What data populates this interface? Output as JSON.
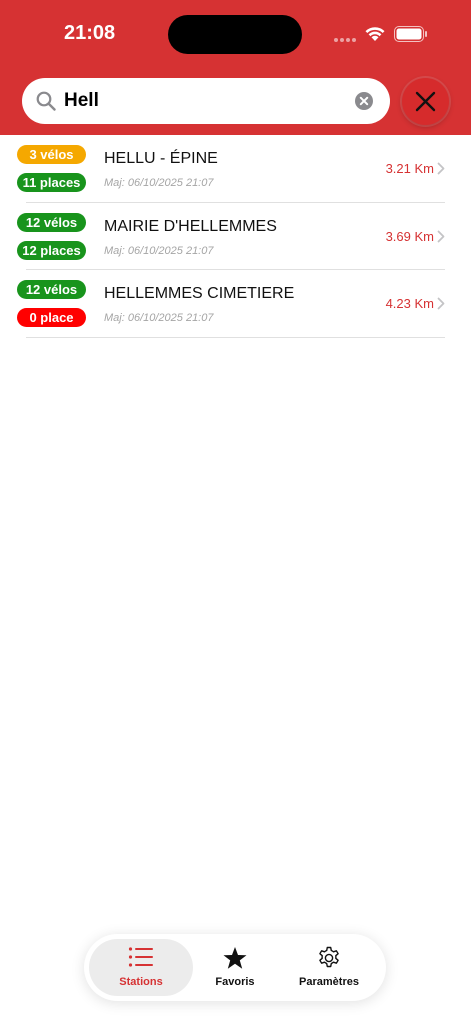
{
  "status_bar": {
    "time": "21:08"
  },
  "search": {
    "value": "Hell"
  },
  "stations": [
    {
      "name": "HELLU - ÉPINE",
      "bikes": "3 vélos",
      "bikes_color": "#f5a800",
      "places": "11 places",
      "places_color": "#18941c",
      "updated": "Maj: 06/10/2025 21:07",
      "distance": "3.21 Km"
    },
    {
      "name": "MAIRIE D'HELLEMMES",
      "bikes": "12 vélos",
      "bikes_color": "#18941c",
      "places": "12 places",
      "places_color": "#18941c",
      "updated": "Maj: 06/10/2025 21:07",
      "distance": "3.69 Km"
    },
    {
      "name": "HELLEMMES CIMETIERE",
      "bikes": "12 vélos",
      "bikes_color": "#18941c",
      "places": "0 place",
      "places_color": "#ff0000",
      "updated": "Maj: 06/10/2025 21:07",
      "distance": "4.23 Km"
    }
  ],
  "tabbar": {
    "stations_label": "Stations",
    "favoris_label": "Favoris",
    "params_label": "Paramètres",
    "active": "stations"
  },
  "colors": {
    "brand_red": "#d63233",
    "active_tab": "#d63233"
  }
}
